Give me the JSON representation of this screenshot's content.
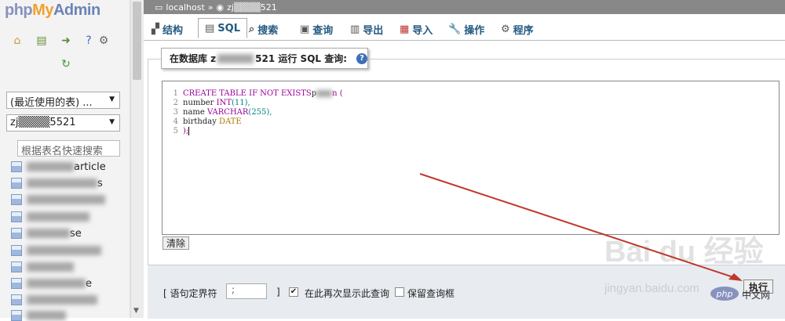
{
  "logo": {
    "php": "php",
    "my": "My",
    "admin": "Admin"
  },
  "left_icons": [
    "home-icon",
    "sql-icon",
    "exit-icon",
    "help-icon",
    "settings-icon",
    "reload-icon"
  ],
  "recent_select": "(最近使用的表) ...",
  "db_select": "zj▒▒▒▒5521",
  "table_filter_placeholder": "根据表名快速搜索",
  "tables": [
    {
      "label": "article"
    },
    {
      "label": "s"
    },
    {
      "label": ""
    },
    {
      "label": ""
    },
    {
      "label": "se"
    },
    {
      "label": ""
    },
    {
      "label": ""
    },
    {
      "label": "e"
    },
    {
      "label": "e"
    },
    {
      "label": ""
    }
  ],
  "breadcrumb": {
    "server": "localhost",
    "db": "zj▒▒▒▒521"
  },
  "tabs": [
    {
      "label": "结构",
      "icon": "structure-icon"
    },
    {
      "label": "SQL",
      "icon": "sql-icon"
    },
    {
      "label": "搜索",
      "icon": "search-icon"
    },
    {
      "label": "查询",
      "icon": "query-icon"
    },
    {
      "label": "导出",
      "icon": "export-icon"
    },
    {
      "label": "导入",
      "icon": "import-icon"
    },
    {
      "label": "操作",
      "icon": "wrench-icon"
    },
    {
      "label": "程序",
      "icon": "routines-icon"
    }
  ],
  "legend": {
    "prefix": "在数据库 z",
    "suffix": "521 运行 SQL 查询:"
  },
  "sql_lines": [
    {
      "num": "1",
      "kw": "CREATE TABLE IF NOT EXISTS",
      "rest": " p",
      "tail": "n ("
    },
    {
      "num": "2",
      "col": "number",
      "type": "INT",
      "arg": "(11),"
    },
    {
      "num": "3",
      "col": "name",
      "type": "VARCHAR",
      "arg": "(255),"
    },
    {
      "num": "4",
      "col": "birthday",
      "type": "DATE",
      "arg": ""
    },
    {
      "num": "5",
      "end": ");"
    }
  ],
  "clear_button": "清除",
  "delimiter_label": "[ 语句定界符",
  "delimiter_value": ";",
  "delimiter_close": "]",
  "show_again_label": "在此再次显示此查询",
  "keep_box_label": "保留查询框",
  "go_button": "执行",
  "watermark": {
    "main": "Bai du 经验",
    "sub": "jingyan.baidu.com"
  },
  "corner_php": "php",
  "corner_cn": "中文网"
}
